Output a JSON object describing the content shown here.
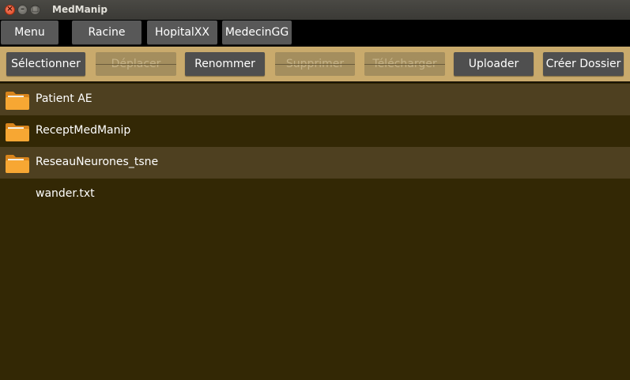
{
  "window": {
    "title": "MedManip"
  },
  "nav": {
    "menu_label": "Menu",
    "breadcrumb": [
      "Racine",
      "HopitalXX",
      "MedecinGG"
    ]
  },
  "toolbar": {
    "select_label": "Sélectionner",
    "move_label": "Déplacer",
    "rename_label": "Renommer",
    "delete_label": "Supprimer",
    "download_label": "Télécharger",
    "upload_label": "Uploader",
    "create_folder_label": "Créer Dossier"
  },
  "files": [
    {
      "name": "Patient AE",
      "type": "folder"
    },
    {
      "name": "ReceptMedManip",
      "type": "folder"
    },
    {
      "name": "ReseauNeurones_tsne",
      "type": "folder"
    },
    {
      "name": "wander.txt",
      "type": "file"
    }
  ],
  "colors": {
    "background": "#332805",
    "row_alt": "#4e4020",
    "toolbar": "#c9aa6c",
    "button": "#4f4f4f",
    "folder": "#f7a733"
  }
}
